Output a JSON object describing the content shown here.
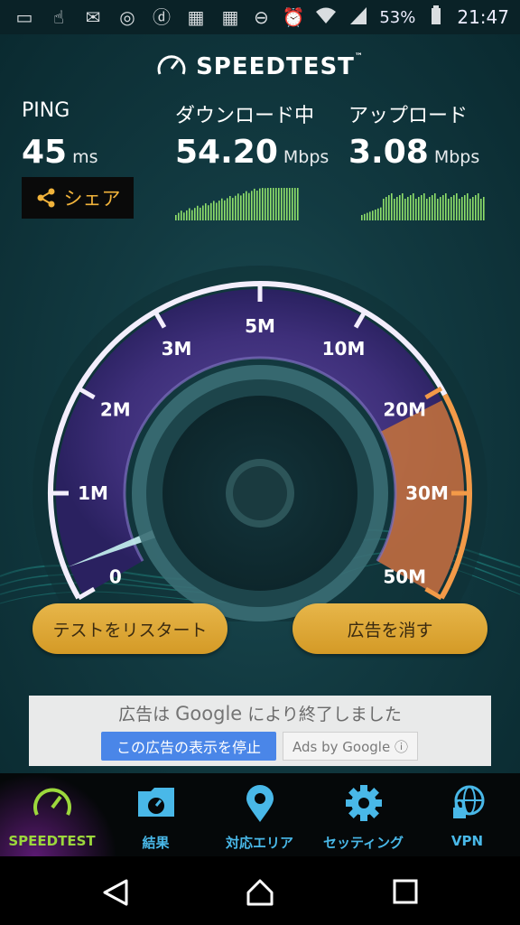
{
  "status_bar": {
    "battery_percent": "53%",
    "time": "21:47",
    "left_icons": [
      "message-icon",
      "hand-icon",
      "mail-icon",
      "chrome-icon",
      "d-icon",
      "calendar-icon",
      "calendar-icon"
    ],
    "right_icons": [
      "dnd-icon",
      "alarm-icon",
      "wifi-icon",
      "signal-icon",
      "battery-icon"
    ]
  },
  "header": {
    "brand": "SPEEDTEST",
    "trademark": "™"
  },
  "metrics": {
    "ping": {
      "label": "PING",
      "value": "45",
      "unit": "ms"
    },
    "download": {
      "label": "ダウンロード中",
      "value": "54.20",
      "unit": "Mbps"
    },
    "upload": {
      "label": "アップロード",
      "value": "3.08",
      "unit": "Mbps"
    }
  },
  "share_button": {
    "label": "シェア"
  },
  "gauge": {
    "ticks": [
      "0",
      "1M",
      "2M",
      "3M",
      "5M",
      "10M",
      "20M",
      "30M",
      "50M"
    ],
    "needle_value_mbps": 0.3
  },
  "buttons": {
    "restart": "テストをリスタート",
    "remove_ads": "広告を消す"
  },
  "ad": {
    "line_pre": "広告は",
    "google": "Google",
    "line_post": "により終了しました",
    "stop_label": "この広告の表示を停止",
    "ads_by": "Ads by Google ⓘ"
  },
  "bottom_nav": {
    "items": [
      {
        "label": "SPEEDTEST",
        "icon": "speedometer-icon",
        "active": true
      },
      {
        "label": "結果",
        "icon": "results-folder-icon",
        "active": false
      },
      {
        "label": "対応エリア",
        "icon": "map-pin-icon",
        "active": false
      },
      {
        "label": "セッティング",
        "icon": "gear-icon",
        "active": false
      },
      {
        "label": "VPN",
        "icon": "globe-lock-icon",
        "active": false
      }
    ]
  },
  "colors": {
    "accent_gold": "#e0a93a",
    "accent_blue": "#49b8e8",
    "active_green": "#9cd83c",
    "gauge_orange": "#e4823a"
  }
}
